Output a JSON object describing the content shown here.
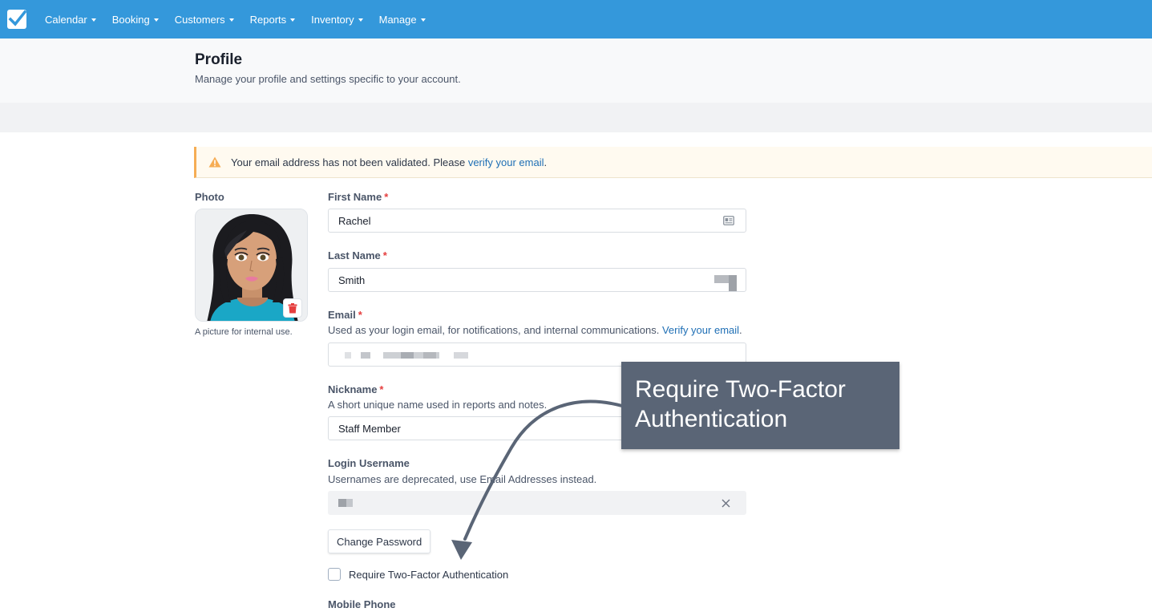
{
  "nav": {
    "items": [
      {
        "label": "Calendar"
      },
      {
        "label": "Booking"
      },
      {
        "label": "Customers"
      },
      {
        "label": "Reports"
      },
      {
        "label": "Inventory"
      },
      {
        "label": "Manage"
      }
    ]
  },
  "header": {
    "title": "Profile",
    "subtitle": "Manage your profile and settings specific to your account."
  },
  "alert": {
    "text": "Your email address has not been validated. Please ",
    "link": "verify your email",
    "suffix": "."
  },
  "photo": {
    "label": "Photo",
    "help": "A picture for internal use."
  },
  "form": {
    "first_name": {
      "label": "First Name",
      "required": "*",
      "value": "Rachel"
    },
    "last_name": {
      "label": "Last Name",
      "required": "*",
      "value": "Smith"
    },
    "email": {
      "label": "Email",
      "required": "*",
      "help": "Used as your login email, for notifications, and internal communications. ",
      "help_link": "Verify your email",
      "help_suffix": "."
    },
    "nickname": {
      "label": "Nickname",
      "required": "*",
      "help": "A short unique name used in reports and notes.",
      "value": "Staff Member"
    },
    "username": {
      "label": "Login Username",
      "help": "Usernames are deprecated, use Email Addresses instead."
    },
    "change_password": "Change Password",
    "two_factor_label": "Require Two-Factor Authentication",
    "mobile_phone_label": "Mobile Phone"
  },
  "callout": {
    "line1": "Require Two-Factor",
    "line2": "Authentication"
  },
  "colors": {
    "nav": "#3498db",
    "callout": "#5a6576",
    "alert_border": "#f6ad55",
    "link": "#1f6fb5"
  }
}
